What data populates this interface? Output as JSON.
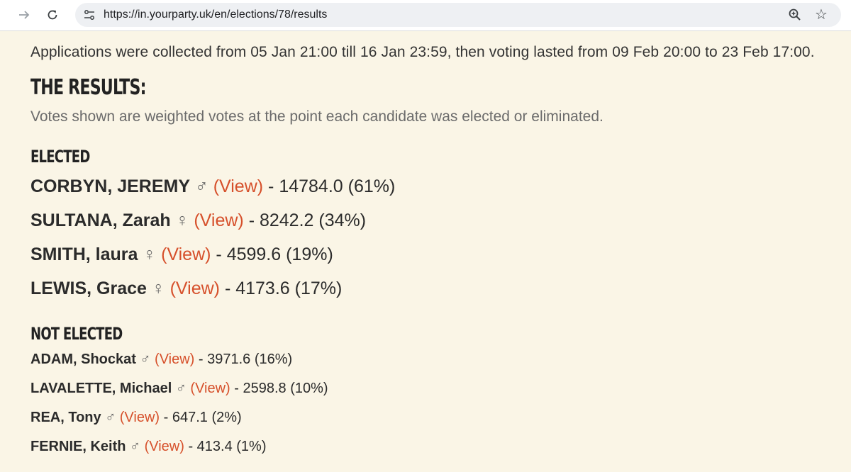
{
  "browser": {
    "url": "https://in.yourparty.uk/en/elections/78/results",
    "forward_icon": "arrow-right-icon",
    "reload_icon": "reload-icon",
    "site_info_icon": "tune-icon",
    "zoom_icon": "zoom-in-icon",
    "bookmark_icon": "star-icon"
  },
  "page": {
    "intro": "Applications were collected from 05 Jan 21:00 till 16 Jan 23:59, then voting lasted from 09 Feb 20:00 to 23 Feb 17:00.",
    "results_heading": "THE RESULTS:",
    "note": "Votes shown are weighted votes at the point each candidate was elected or eliminated.",
    "view_label": "(View)",
    "elected_heading": "ELECTED",
    "not_elected_heading": "NOT ELECTED",
    "link_color": "#d6502b",
    "background_color": "#faf5e6"
  },
  "elected": [
    {
      "name": "CORBYN, JEREMY",
      "gender": "♂",
      "result": "- 14784.0 (61%)"
    },
    {
      "name": "SULTANA, Zarah",
      "gender": "♀",
      "result": "- 8242.2 (34%)"
    },
    {
      "name": "SMITH, laura",
      "gender": "♀",
      "result": "- 4599.6 (19%)"
    },
    {
      "name": "LEWIS, Grace",
      "gender": "♀",
      "result": "- 4173.6 (17%)"
    }
  ],
  "not_elected": [
    {
      "name": "ADAM, Shockat",
      "gender": "♂",
      "result": "- 3971.6 (16%)"
    },
    {
      "name": "LAVALETTE, Michael",
      "gender": "♂",
      "result": "- 2598.8 (10%)"
    },
    {
      "name": "REA, Tony",
      "gender": "♂",
      "result": "- 647.1 (2%)"
    },
    {
      "name": "FERNIE, Keith",
      "gender": "♂",
      "result": "- 413.4 (1%)"
    }
  ]
}
